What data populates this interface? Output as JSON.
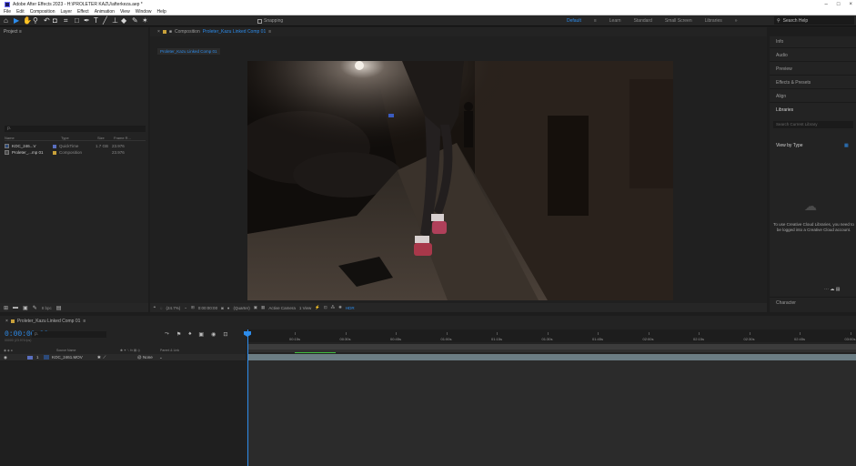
{
  "app": {
    "title": "Adobe After Effects 2023 - H:\\PROLETER KAZU\\afterkeza.aep *",
    "window_controls": [
      "–",
      "□",
      "×"
    ]
  },
  "menu": [
    "File",
    "Edit",
    "Composition",
    "Layer",
    "Effect",
    "Animation",
    "View",
    "Window",
    "Help"
  ],
  "toolbar": {
    "snapping_label": "Snapping",
    "workspaces": [
      "Default",
      "≡",
      "Learn",
      "Standard",
      "Small Screen",
      "Libraries",
      "»"
    ],
    "search_help_placeholder": "Search Help"
  },
  "project": {
    "tab_label": "Project ≡",
    "search_placeholder": "ρ.",
    "columns": [
      "Name",
      "Type",
      "Size",
      "Frame R..."
    ],
    "items": [
      {
        "name": "KOC_246...V",
        "type": "QuickTime",
        "size": "1.7 GB",
        "fps": "23.976",
        "color": "#5a6fbf"
      },
      {
        "name": "Proleter_...mp 01",
        "type": "Composition",
        "size": "",
        "fps": "23.976",
        "color": "#c9a13a"
      }
    ],
    "bpc": "8 bpc"
  },
  "composition": {
    "tab_prefix": "Composition",
    "tab_name": "Proleter_Kazu Linked Comp 01",
    "flow_tab": "Proleter_Kazu Linked Comp 01",
    "zoom": "(24.7%)",
    "timecode": "0:00:00:00",
    "resolution": "(Quarter)",
    "camera": "Active Camera",
    "view": "1 View",
    "hdr": "HDR"
  },
  "right_panel": {
    "items": [
      "Info",
      "Audio",
      "Preview",
      "Effects & Presets",
      "Align",
      "Libraries"
    ],
    "lib_search_placeholder": "Search Current Library",
    "view_by_type": "View by Type",
    "lib_message": "To use Creative Cloud Libraries, you need to be logged into a Creative Cloud account.",
    "character": "Character"
  },
  "timeline": {
    "tab_label": "Proleter_Kazu Linked Comp 01",
    "timecode": "0:00:00:00",
    "timecode_sub": "00000 (23.976 fps)",
    "search_placeholder": "ρ.",
    "header": [
      "Source Name",
      "Parent & Link"
    ],
    "layer": {
      "index": "1",
      "name": "KOC_2461.MOV",
      "parent": "None"
    },
    "ruler_labels": [
      "00:15s",
      "00:30s",
      "00:45s",
      "01:00s",
      "01:15s",
      "01:30s",
      "01:45s",
      "02:00s",
      "02:15s",
      "02:30s",
      "02:45s",
      "03:00s"
    ]
  },
  "colors": {
    "accent": "#2d8ceb",
    "layer_bar": "#6b7d84",
    "work_bar": "#3fbf3f"
  }
}
